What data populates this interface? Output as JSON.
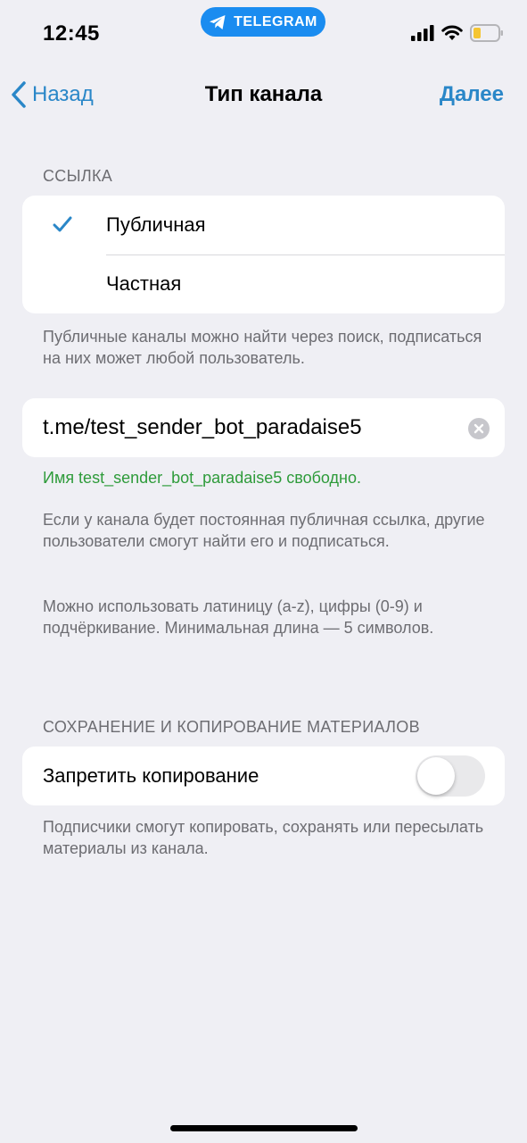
{
  "status_bar": {
    "time": "12:45",
    "app_pill_label": "TELEGRAM",
    "accent_color": "#1a8cf0"
  },
  "nav": {
    "back_label": "Назад",
    "title": "Тип канала",
    "next_label": "Далее",
    "accent_color": "#2a87c8"
  },
  "link_section": {
    "header": "ССЫЛКА",
    "options": [
      {
        "label": "Публичная",
        "selected": true
      },
      {
        "label": "Частная",
        "selected": false
      }
    ],
    "footnote": "Публичные каналы можно найти через поиск, подписаться на них может любой пользователь."
  },
  "link_field": {
    "value": "t.me/test_sender_bot_paradaise5",
    "clear_icon": "clear-icon",
    "availability_text": "Имя test_sender_bot_paradaise5 свободно.",
    "availability_color": "#2e9b3a",
    "hint_1": "Если у канала будет постоянная публичная ссылка, другие пользователи смогут найти его и подписаться.",
    "hint_2": "Можно использовать латиницу (a-z), цифры (0-9) и подчёркивание. Минимальная длина — 5 символов."
  },
  "content_section": {
    "header": "СОХРАНЕНИЕ И КОПИРОВАНИЕ МАТЕРИАЛОВ",
    "toggle_label": "Запретить копирование",
    "toggle_on": false,
    "footnote": "Подписчики смогут копировать, сохранять или пересылать материалы из канала."
  }
}
